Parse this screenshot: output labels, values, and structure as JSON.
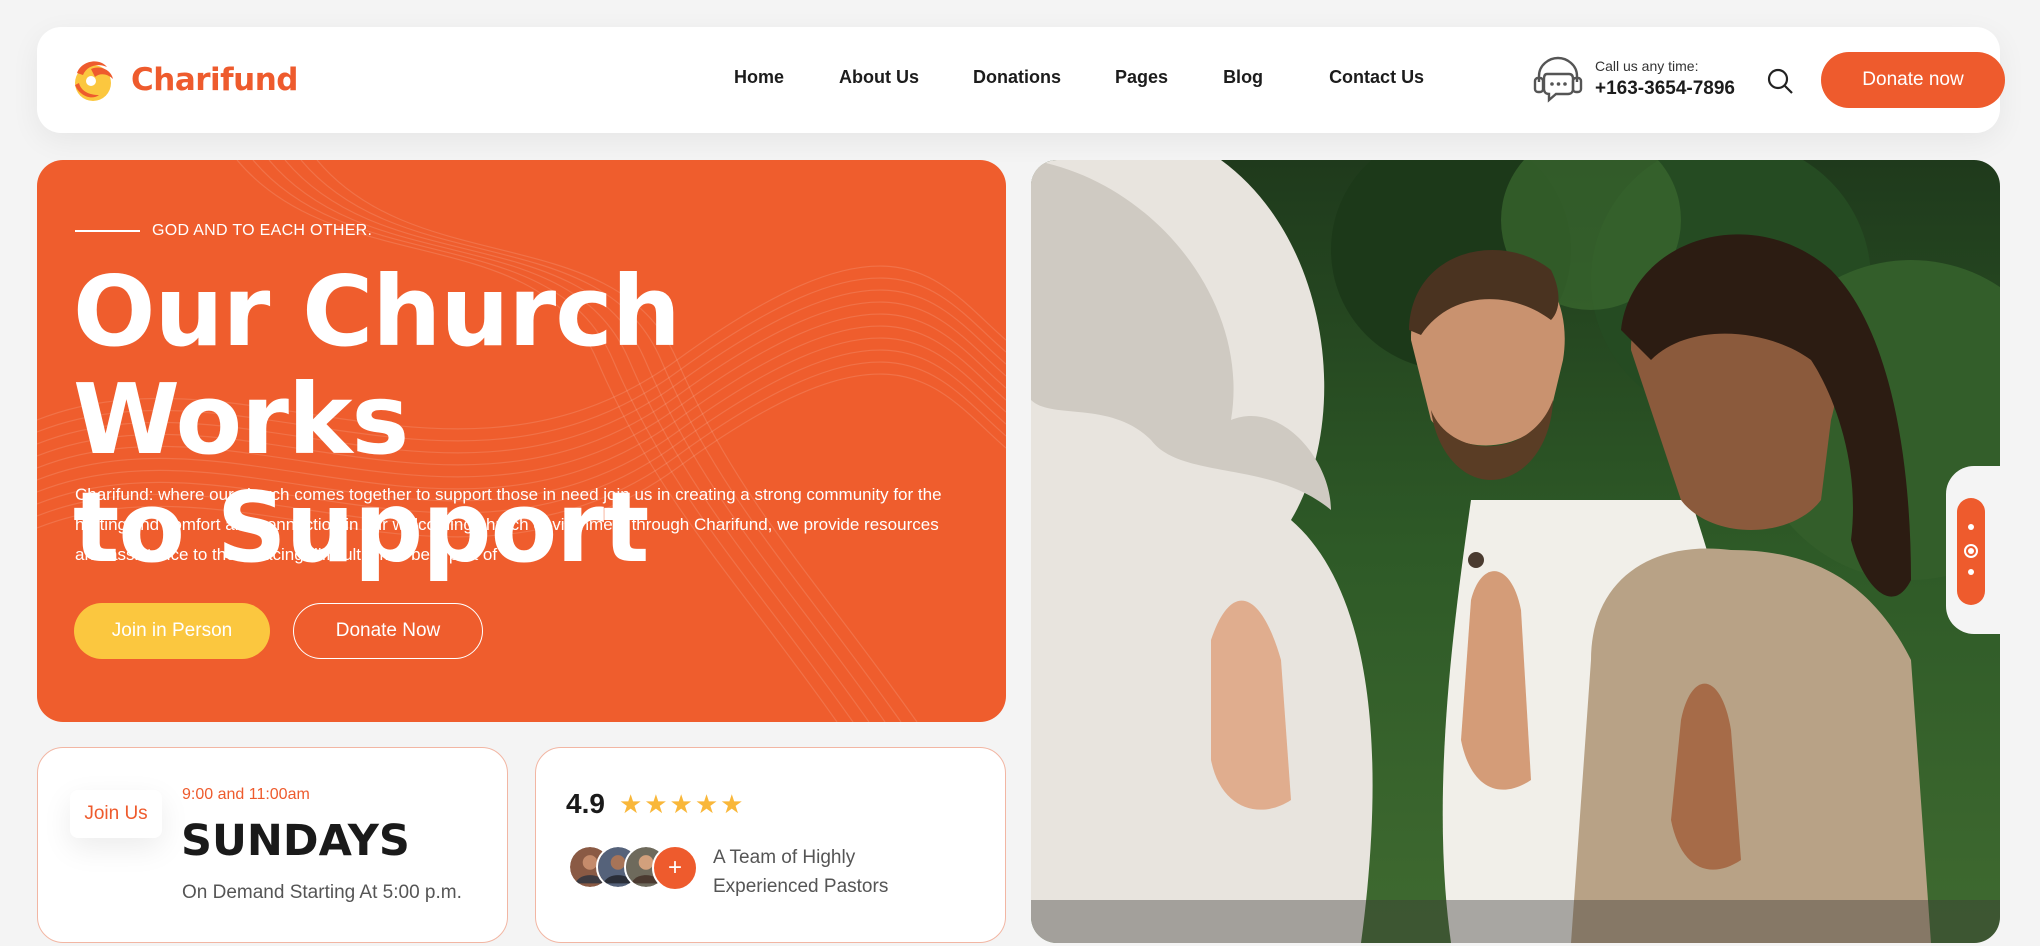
{
  "brand": {
    "name": "Charifund",
    "accent": "#ee5b2d",
    "yellow": "#fbc73f"
  },
  "nav": [
    {
      "label": "Home"
    },
    {
      "label": "About Us"
    },
    {
      "label": "Donations"
    },
    {
      "label": "Pages"
    },
    {
      "label": "Blog"
    },
    {
      "label": "Contact Us"
    }
  ],
  "call": {
    "label": "Call us any time:",
    "phone": "+163-3654-7896",
    "icon": "headset-icon"
  },
  "header": {
    "donate_label": "Donate now",
    "search_icon": "search-icon"
  },
  "hero": {
    "tagline": "GOD AND TO EACH OTHER.",
    "title_line1": "Our Church Works",
    "title_line2": "to Support",
    "description": "Charifund: where our church comes together to support those in need join us in creating a strong community for the hurting find comfort and connection in our welcoming church environment through Charifund, we provide resources and assistance to those facing difficult times be a part of",
    "btn_join": "Join in Person",
    "btn_donate": "Donate Now"
  },
  "schedule_card": {
    "badge": "Join Us",
    "time": "9:00 and 11:00am",
    "day": "SUNDAYS",
    "sub": "On Demand Starting At 5:00 p.m."
  },
  "team_card": {
    "rating": "4.9",
    "stars": "★★★★★",
    "star_count": 5,
    "plus": "+",
    "text_line1": "A Team of Highly",
    "text_line2": "Experienced Pastors"
  },
  "slider": {
    "total": 3,
    "active_index": 1
  }
}
